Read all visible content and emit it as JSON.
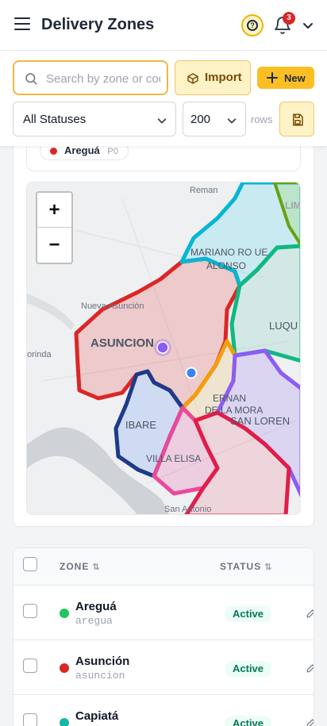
{
  "header": {
    "title": "Delivery Zones",
    "notifications": "3",
    "colors": {
      "accent": "#fbbf24",
      "accent_border": "#f5b642"
    }
  },
  "toolbar": {
    "search_placeholder": "Search by zone or code",
    "import_label": "Import",
    "new_label": "New",
    "status_filter": "All Statuses",
    "rows_value": "200",
    "rows_label": "rows"
  },
  "legend": {
    "items": [
      {
        "name": "Areguá",
        "code": "P0",
        "color": "#dc2626"
      }
    ]
  },
  "map": {
    "zoom_in": "+",
    "zoom_out": "−",
    "labels": {
      "reman": "Reman",
      "lim": "LIM",
      "mariano1": "MARIANO RO   UE",
      "mariano2": "ALONSO",
      "luque": "LUQU",
      "nueva": "Nueva Asunción",
      "asuncion": "ASUNCION",
      "orinda": "orinda",
      "fernando1": "ERNAN",
      "fernando2": "DE LA MORA",
      "sanlorenzo": "SAN LOREN",
      "ibare": "IBARE",
      "villaelisa": "VILLA ELISA",
      "santonio": "San Antonio"
    }
  },
  "table": {
    "columns": {
      "zone": "ZONE",
      "status": "STATUS",
      "sort_glyph": "⇅"
    },
    "rows": [
      {
        "name": "Areguá",
        "code": "aregua",
        "status": "Active",
        "dot": "#22c55e"
      },
      {
        "name": "Asunción",
        "code": "asuncion",
        "status": "Active",
        "dot": "#dc2626"
      },
      {
        "name": "Capiatá",
        "code": "capiata",
        "status": "Active",
        "dot": "#14b8a6"
      }
    ]
  }
}
